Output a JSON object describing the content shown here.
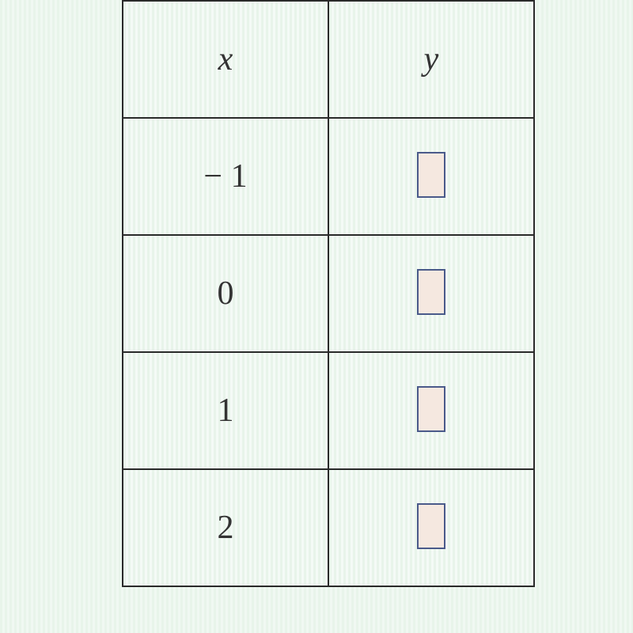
{
  "chart_data": {
    "type": "table",
    "columns": [
      "x",
      "y"
    ],
    "rows": [
      {
        "x": "− 1",
        "y": ""
      },
      {
        "x": "0",
        "y": ""
      },
      {
        "x": "1",
        "y": ""
      },
      {
        "x": "2",
        "y": ""
      }
    ]
  },
  "headers": {
    "col1": "x",
    "col2": "y"
  },
  "values": {
    "row1_x": "− 1",
    "row2_x": "0",
    "row3_x": "1",
    "row4_x": "2"
  }
}
